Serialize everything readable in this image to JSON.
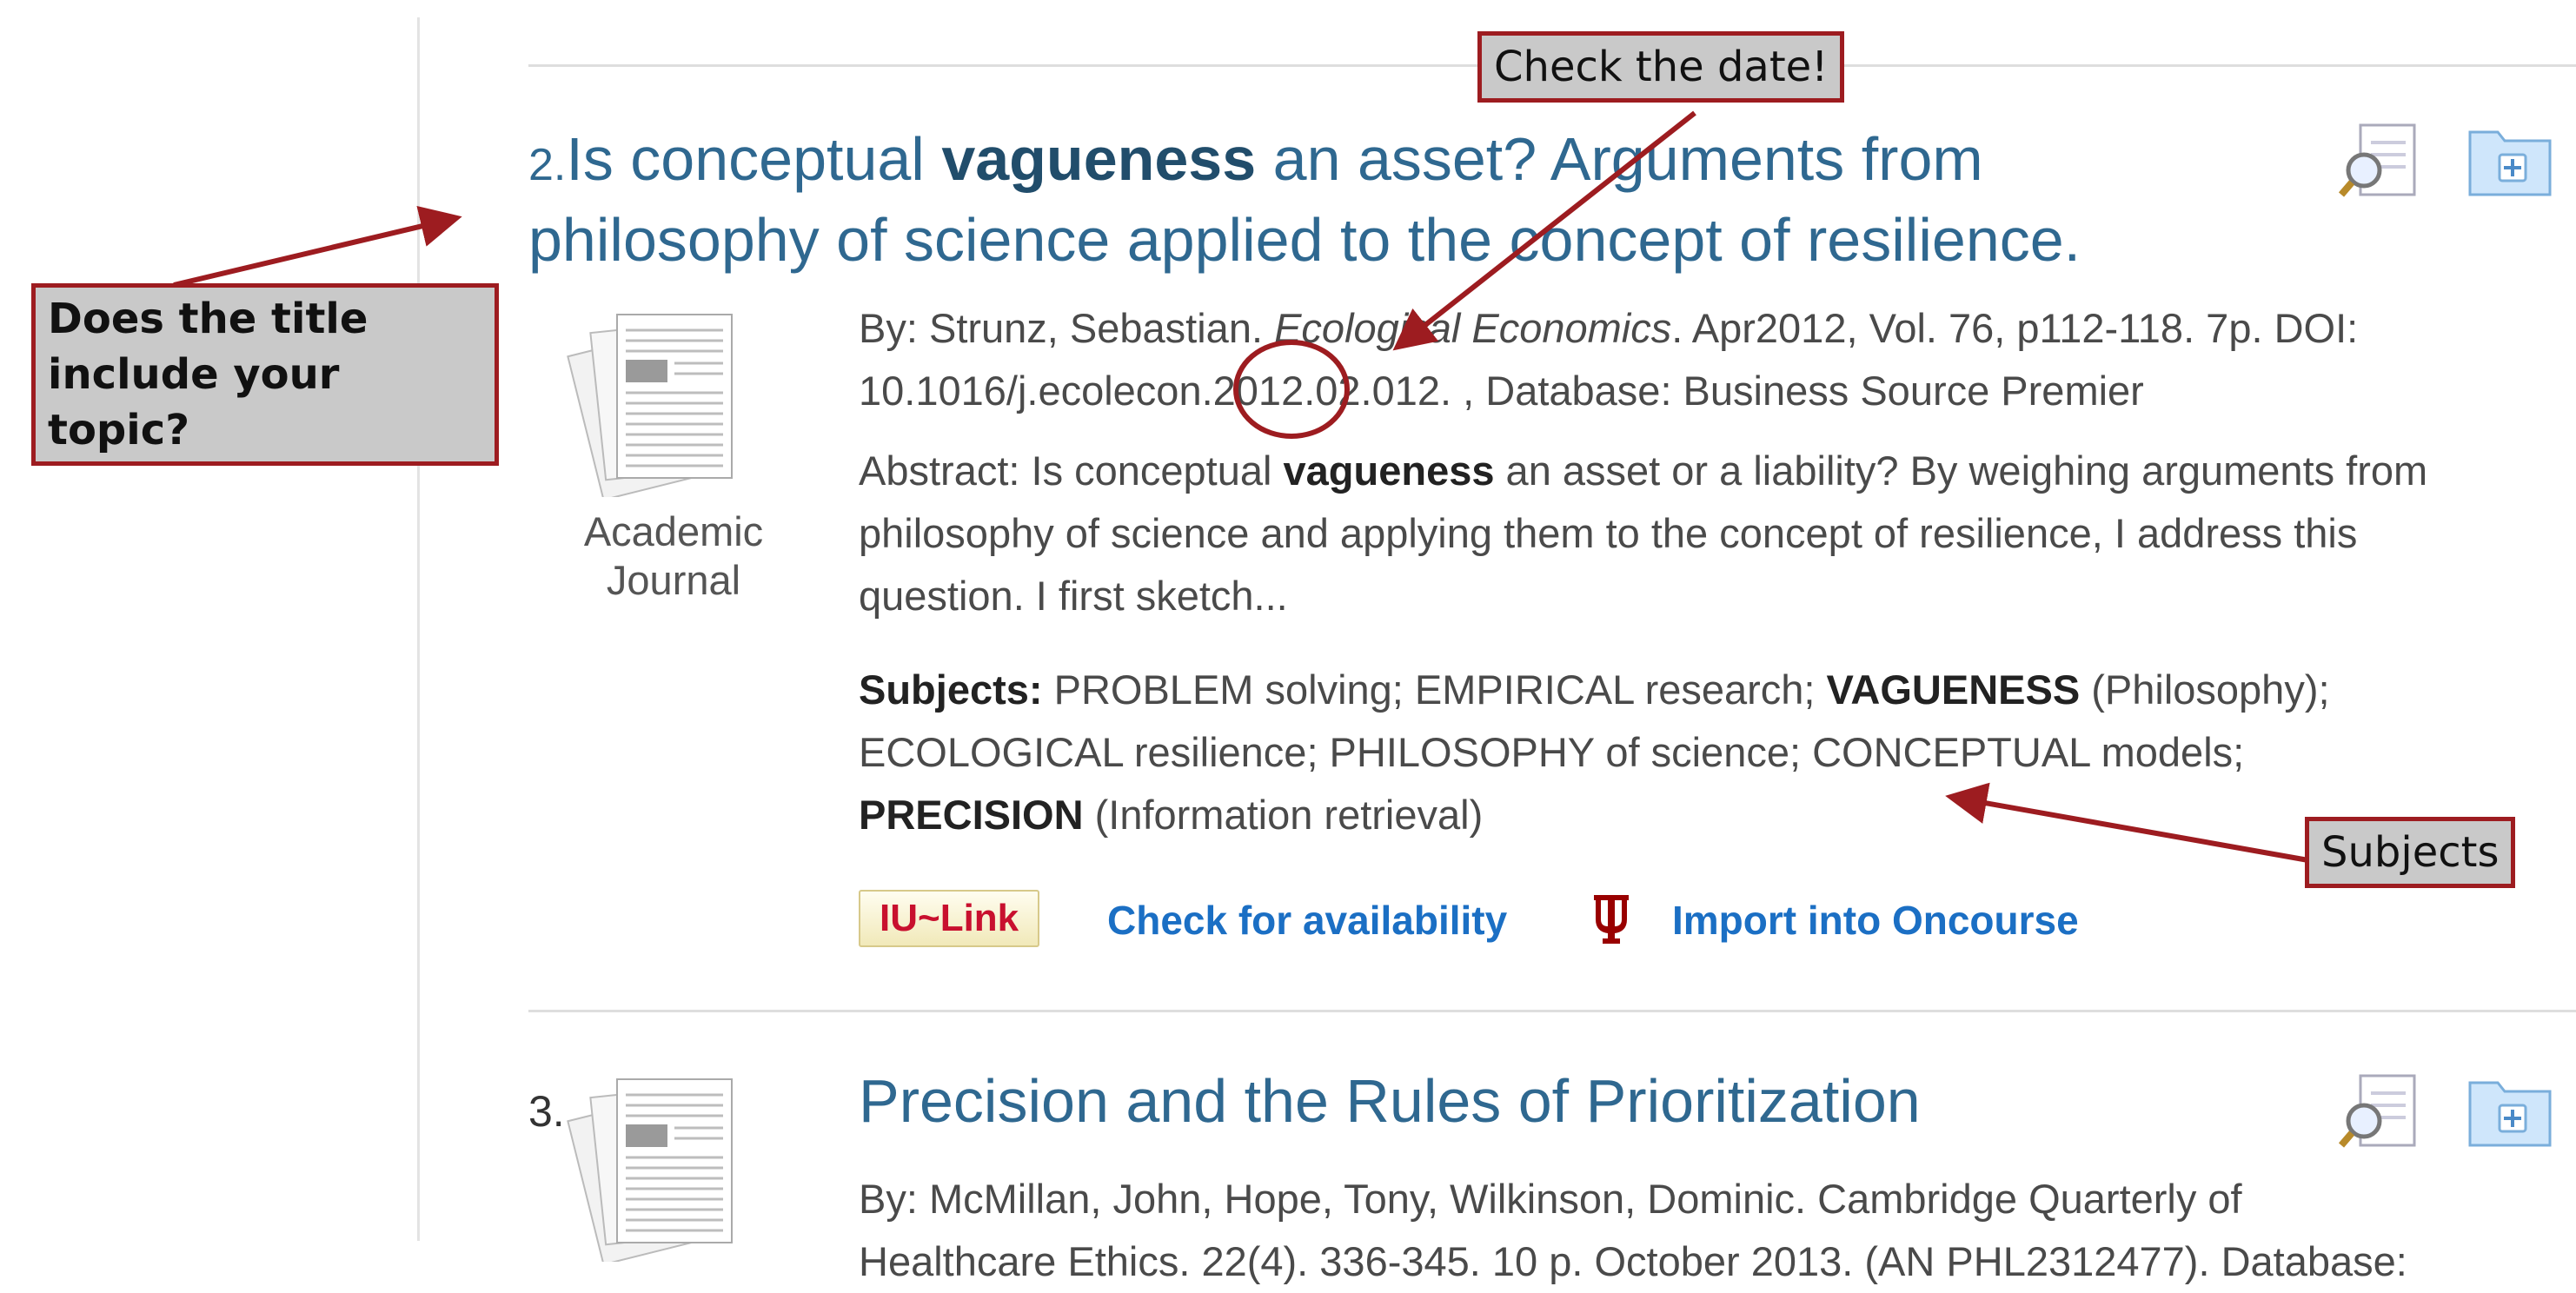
{
  "results": [
    {
      "number": "2.",
      "title_pre": "Is conceptual ",
      "title_bold": "vagueness",
      "title_line1_rest": " an asset? Arguments from",
      "title_line2": "philosophy of science applied to the concept of resilience.",
      "type_line1": "Academic",
      "type_line2": "Journal",
      "byline_pre": "By: Strunz, Sebastian. ",
      "byline_journal": "Ecological Economics",
      "byline_post": ". Apr2012, Vol. 76, p112-118. 7p. DOI:",
      "byline_line2": "10.1016/j.ecolecon.2012.02.012. , Database: Business Source Premier",
      "abstract_pre": "Abstract: Is conceptual ",
      "abstract_bold": "vagueness",
      "abstract_line1_rest": " an asset or a liability? By weighing arguments from",
      "abstract_line2": "philosophy of science and applying them to the concept of resilience, I address this",
      "abstract_line3": "question. I first sketch...",
      "subjects_label": "Subjects:",
      "subjects_line1_a": " PROBLEM solving; EMPIRICAL research; ",
      "subjects_line1_bold": "VAGUENESS",
      "subjects_line1_b": " (Philosophy);",
      "subjects_line2": "ECOLOGICAL resilience; PHILOSOPHY of science; CONCEPTUAL models;",
      "subjects_line3_bold": "PRECISION",
      "subjects_line3_rest": " (Information retrieval)",
      "iulink_label": "IU~Link",
      "availability_label": "Check for availability",
      "import_label": "Import into Oncourse"
    },
    {
      "number": "3.",
      "title": "Precision and the Rules of Prioritization",
      "byline": "By: McMillan, John, Hope, Tony, Wilkinson, Dominic. Cambridge Quarterly of",
      "byline_line2": "Healthcare Ethics. 22(4). 336-345. 10 p. October 2013. (AN PHL2312477). Database:"
    }
  ],
  "annotations": {
    "title_question": [
      "Does the title",
      "include your topic?"
    ],
    "date_check": "Check the date!",
    "subjects": "Subjects"
  },
  "colors": {
    "title": "#2f6890",
    "callout_border": "#9d1c20",
    "callout_fill": "#c9c9c9",
    "link": "#1b6fc4",
    "iu_red": "#c8102e"
  },
  "icons": [
    "preview-magnifier-icon",
    "add-to-folder-icon",
    "document-icon",
    "iu-trident-icon"
  ]
}
